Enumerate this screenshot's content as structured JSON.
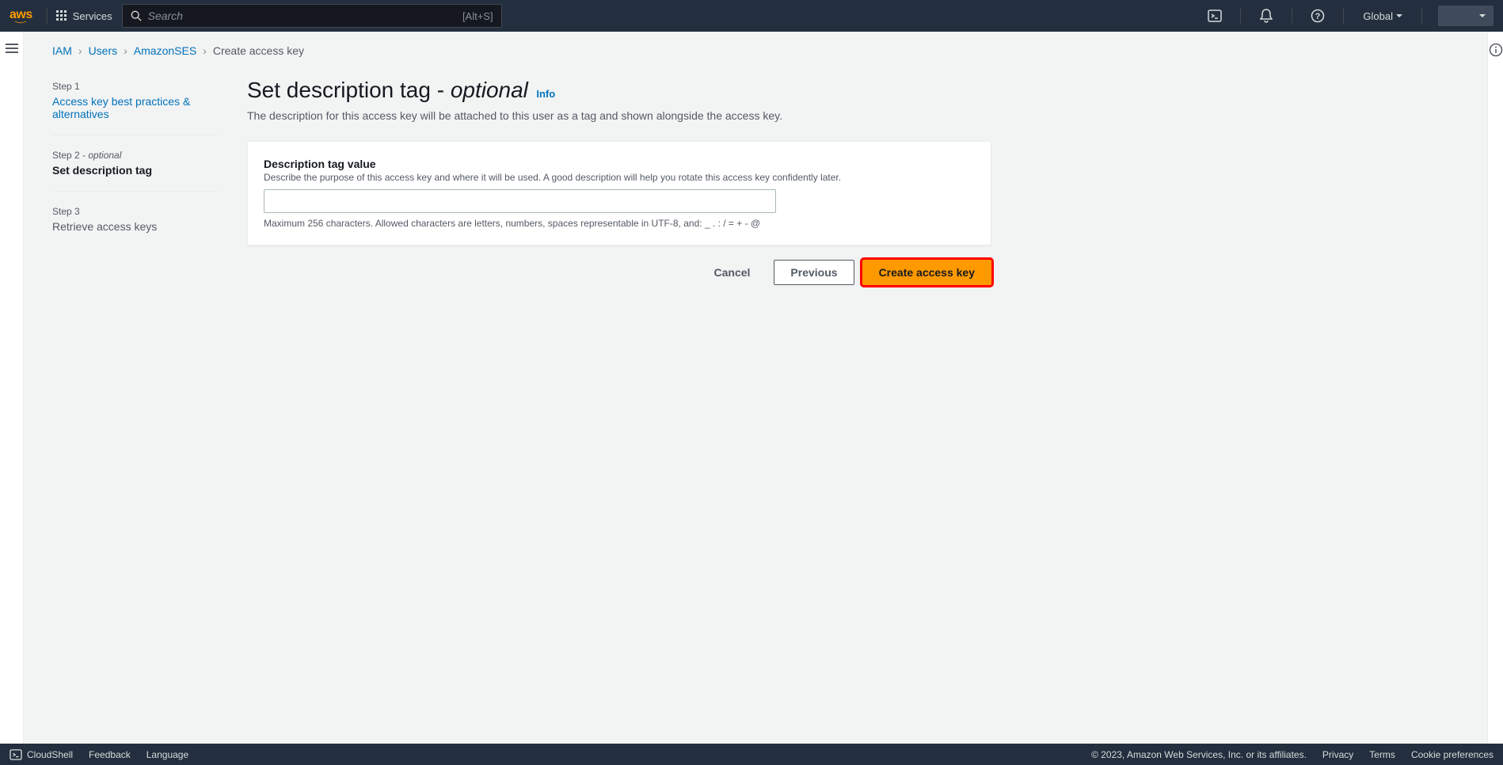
{
  "nav": {
    "logo": "aws",
    "services": "Services",
    "search_placeholder": "Search",
    "search_shortcut": "[Alt+S]",
    "region": "Global"
  },
  "breadcrumb": {
    "items": [
      "IAM",
      "Users",
      "AmazonSES"
    ],
    "current": "Create access key"
  },
  "steps": {
    "s1_label": "Step 1",
    "s1_title": "Access key best practices & alternatives",
    "s2_label": "Step 2 - ",
    "s2_optional": "optional",
    "s2_title": "Set description tag",
    "s3_label": "Step 3",
    "s3_title": "Retrieve access keys"
  },
  "page": {
    "title_main": "Set description tag - ",
    "title_optional": "optional",
    "info": "Info",
    "description": "The description for this access key will be attached to this user as a tag and shown alongside the access key."
  },
  "form": {
    "field_label": "Description tag value",
    "field_desc": "Describe the purpose of this access key and where it will be used. A good description will help you rotate this access key confidently later.",
    "field_value": "",
    "field_constraint": "Maximum 256 characters. Allowed characters are letters, numbers, spaces representable in UTF-8, and: _ . : / = + - @"
  },
  "buttons": {
    "cancel": "Cancel",
    "previous": "Previous",
    "create": "Create access key"
  },
  "footer": {
    "cloudshell": "CloudShell",
    "feedback": "Feedback",
    "language": "Language",
    "copyright": "© 2023, Amazon Web Services, Inc. or its affiliates.",
    "privacy": "Privacy",
    "terms": "Terms",
    "cookies": "Cookie preferences"
  }
}
